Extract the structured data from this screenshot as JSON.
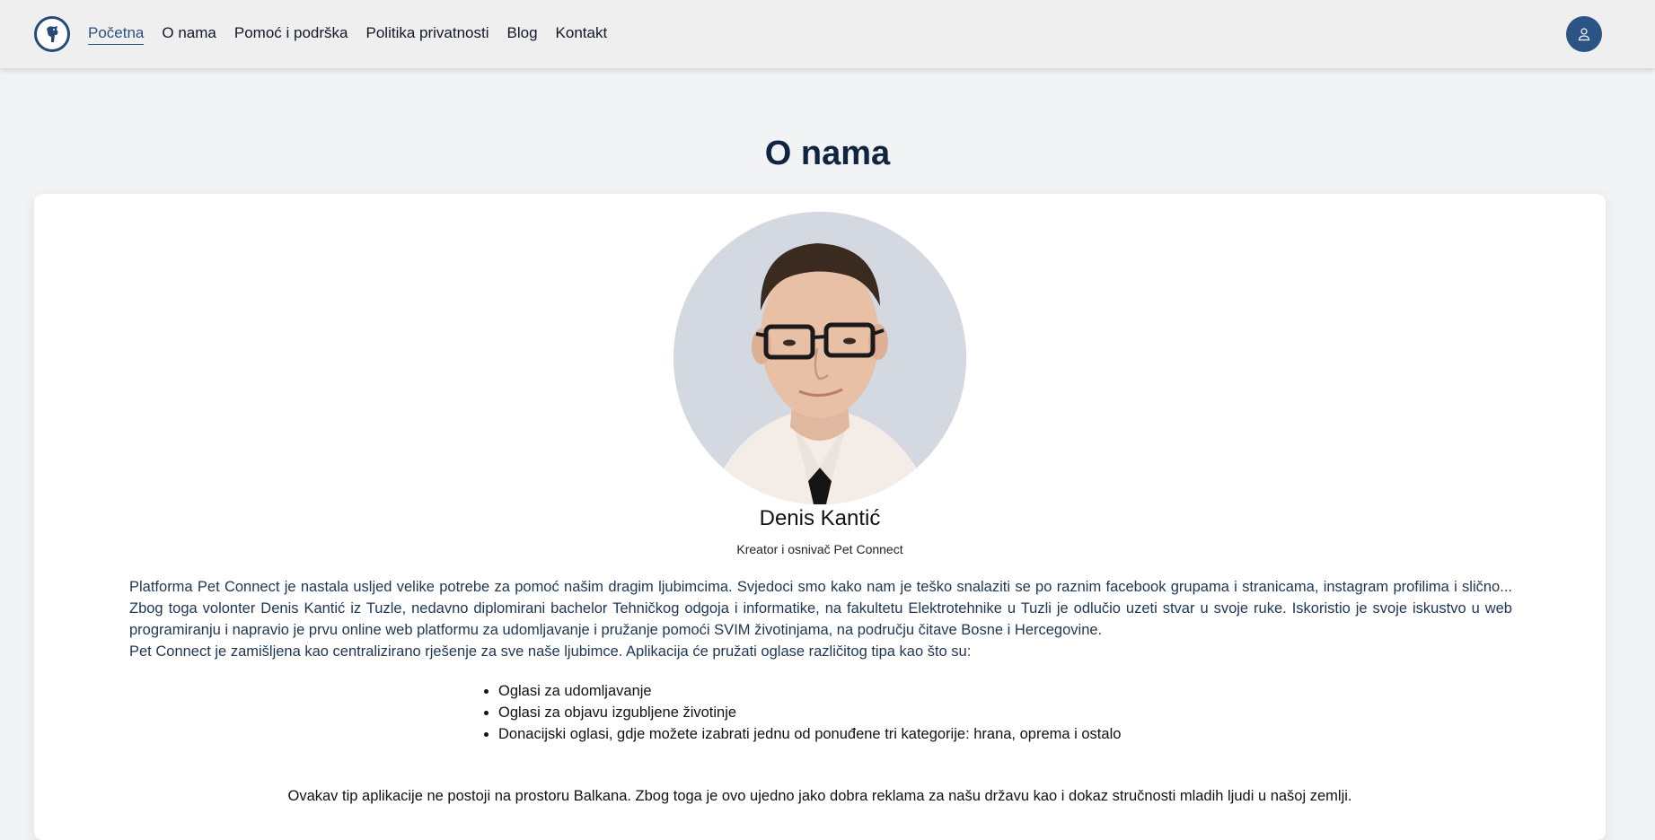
{
  "nav": {
    "logo_icon": "pet-connect-logo-icon",
    "links": [
      {
        "label": "Početna",
        "active": true
      },
      {
        "label": "O nama",
        "active": false
      },
      {
        "label": "Pomoć i podrška",
        "active": false
      },
      {
        "label": "Politika privatnosti",
        "active": false
      },
      {
        "label": "Blog",
        "active": false
      },
      {
        "label": "Kontakt",
        "active": false
      }
    ],
    "user_icon": "user-icon"
  },
  "page": {
    "title": "O nama"
  },
  "profile": {
    "name": "Denis Kantić",
    "role": "Kreator i osnivač Pet Connect"
  },
  "content": {
    "paragraph1": "Platforma Pet Connect je nastala usljed velike potrebe za pomoć našim dragim ljubimcima. Svjedoci smo kako nam je teško snalaziti se po raznim facebook grupama i stranicama, instagram profilima i slično... Zbog toga volonter Denis Kantić iz Tuzle, nedavno diplomirani bachelor Tehničkog odgoja i informatike, na fakultetu Elektrotehnike u Tuzli je odlučio uzeti stvar u svoje ruke. Iskoristio je svoje iskustvo u web programiranju i napravio je prvu online web platformu za udomljavanje i pružanje pomoći SVIM životinjama, na području čitave Bosne i Hercegovine.",
    "paragraph2": "Pet Connect je zamišljena kao centralizirano rješenje za sve naše ljubimce. Aplikacija će pružati oglase različitog tipa kao što su:",
    "list": [
      "Oglasi za udomljavanje",
      "Oglasi za objavu izgubljene životinje",
      "Donacijski oglasi, gdje možete izabrati jednu od ponuđene tri kategorije: hrana, oprema i ostalo"
    ],
    "closing": "Ovakav tip aplikacije ne postoji na prostoru Balkana. Zbog toga je ovo ujedno jako dobra reklama za našu državu kao i dokaz stručnosti mladih ljudi u našoj zemlji."
  },
  "colors": {
    "accent": "#2b5384",
    "title": "#0f2440",
    "background": "#f1f3f5"
  }
}
